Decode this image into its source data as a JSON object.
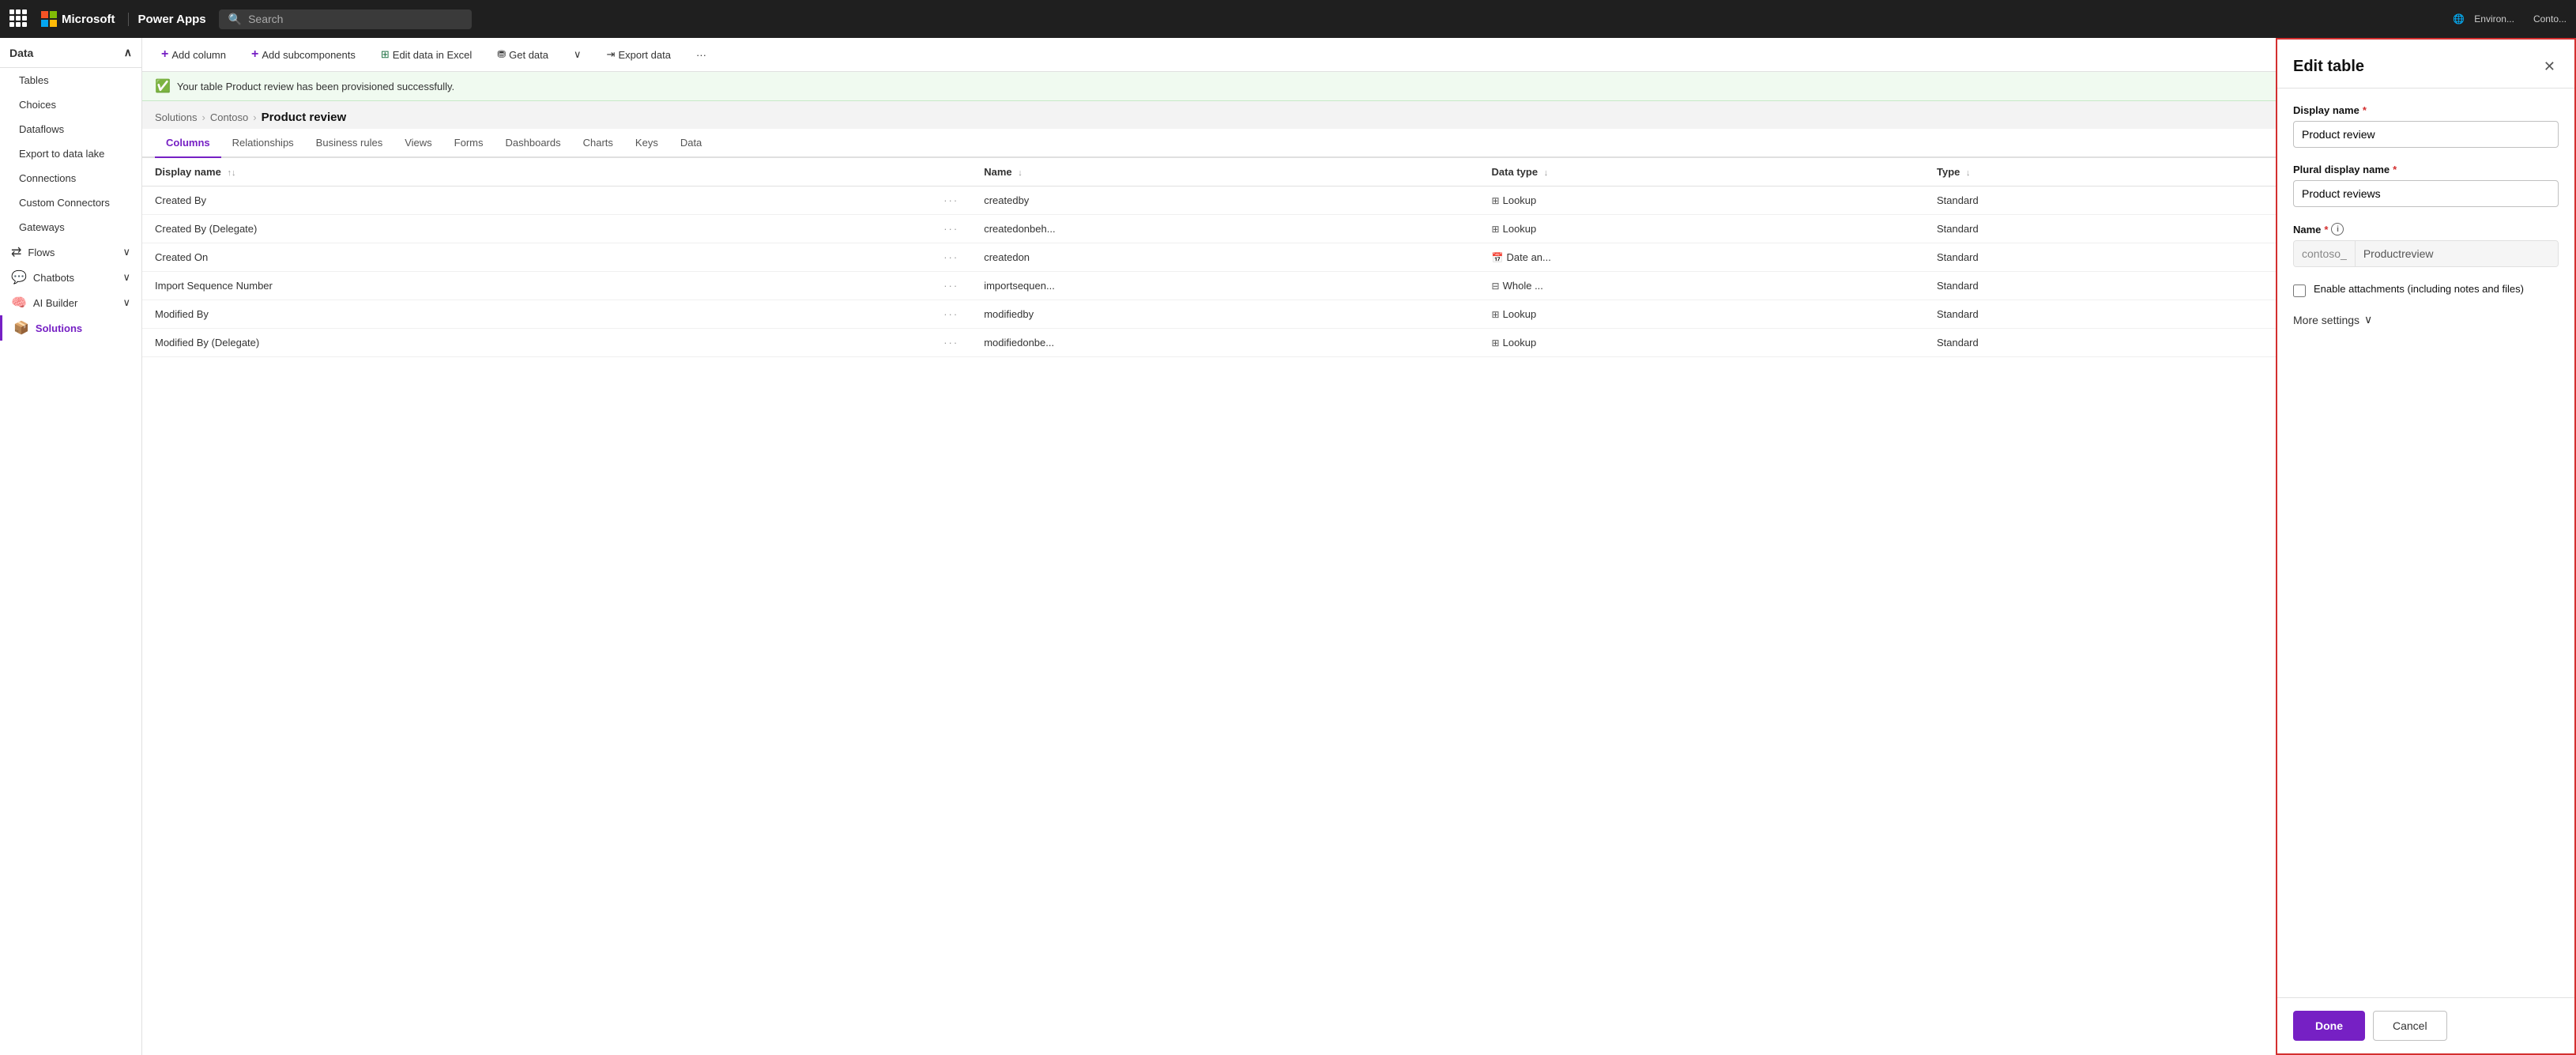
{
  "topnav": {
    "app_title": "Power Apps",
    "search_placeholder": "Search",
    "env_label": "Environ...",
    "env_sub": "Conto..."
  },
  "sidebar": {
    "header": "Data",
    "items": [
      {
        "id": "tables",
        "label": "Tables",
        "active": false,
        "indented": true
      },
      {
        "id": "choices",
        "label": "Choices",
        "active": false,
        "indented": true
      },
      {
        "id": "dataflows",
        "label": "Dataflows",
        "active": false,
        "indented": true
      },
      {
        "id": "export-lake",
        "label": "Export to data lake",
        "active": false,
        "indented": true
      },
      {
        "id": "connections",
        "label": "Connections",
        "active": false,
        "indented": true
      },
      {
        "id": "custom-connectors",
        "label": "Custom Connectors",
        "active": false,
        "indented": true
      },
      {
        "id": "gateways",
        "label": "Gateways",
        "active": false,
        "indented": true
      }
    ],
    "sections": [
      {
        "id": "flows",
        "label": "Flows",
        "icon": "⇄"
      },
      {
        "id": "chatbots",
        "label": "Chatbots",
        "icon": "💬"
      },
      {
        "id": "ai-builder",
        "label": "AI Builder",
        "icon": "🧠"
      },
      {
        "id": "solutions",
        "label": "Solutions",
        "icon": "📦",
        "active": true
      }
    ]
  },
  "toolbar": {
    "add_column": "Add column",
    "add_subcomponents": "Add subcomponents",
    "edit_data_excel": "Edit data in Excel",
    "get_data": "Get data",
    "export_data": "Export data"
  },
  "banner": {
    "message": "Your table Product review has been provisioned successfully."
  },
  "breadcrumb": {
    "solutions": "Solutions",
    "contoso": "Contoso",
    "current": "Product review"
  },
  "tabs": [
    {
      "id": "columns",
      "label": "Columns",
      "active": true
    },
    {
      "id": "relationships",
      "label": "Relationships",
      "active": false
    },
    {
      "id": "business-rules",
      "label": "Business rules",
      "active": false
    },
    {
      "id": "views",
      "label": "Views",
      "active": false
    },
    {
      "id": "forms",
      "label": "Forms",
      "active": false
    },
    {
      "id": "dashboards",
      "label": "Dashboards",
      "active": false
    },
    {
      "id": "charts",
      "label": "Charts",
      "active": false
    },
    {
      "id": "keys",
      "label": "Keys",
      "active": false
    },
    {
      "id": "data",
      "label": "Data",
      "active": false
    }
  ],
  "table": {
    "columns": [
      {
        "id": "display-name",
        "label": "Display name",
        "sort": "↑↓"
      },
      {
        "id": "name",
        "label": "Name",
        "sort": "↓"
      },
      {
        "id": "data-type",
        "label": "Data type",
        "sort": "↓"
      },
      {
        "id": "type",
        "label": "Type",
        "sort": "↓"
      }
    ],
    "rows": [
      {
        "display_name": "Created By",
        "name": "createdby",
        "data_type": "Lookup",
        "type": "Standard",
        "icon": "⊞"
      },
      {
        "display_name": "Created By (Delegate)",
        "name": "createdonbeh...",
        "data_type": "Lookup",
        "type": "Standard",
        "icon": "⊞"
      },
      {
        "display_name": "Created On",
        "name": "createdon",
        "data_type": "Date an...",
        "type": "Standard",
        "icon": "📅"
      },
      {
        "display_name": "Import Sequence Number",
        "name": "importsequen...",
        "data_type": "Whole ...",
        "type": "Standard",
        "icon": "⊟"
      },
      {
        "display_name": "Modified By",
        "name": "modifiedby",
        "data_type": "Lookup",
        "type": "Standard",
        "icon": "⊞"
      },
      {
        "display_name": "Modified By (Delegate)",
        "name": "modifiedonbe...",
        "data_type": "Lookup",
        "type": "Standard",
        "icon": "⊞"
      }
    ]
  },
  "edit_panel": {
    "title": "Edit table",
    "display_name_label": "Display name",
    "display_name_value": "Product review",
    "plural_label": "Plural display name",
    "plural_value": "Product reviews",
    "name_label": "Name",
    "name_prefix": "contoso_",
    "name_value": "Productreview",
    "attachments_label": "Enable attachments (including notes and files)",
    "more_settings": "More settings",
    "done_btn": "Done",
    "cancel_btn": "Cancel"
  }
}
